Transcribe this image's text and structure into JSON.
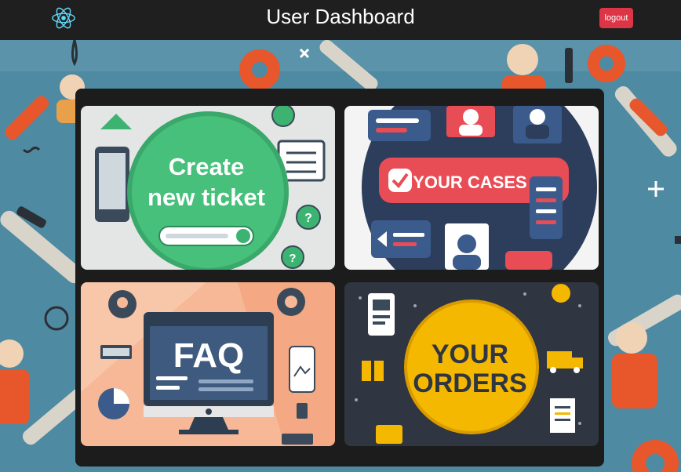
{
  "header": {
    "title": "User Dashboard",
    "logout_label": "logout"
  },
  "cards": {
    "create_ticket": {
      "line1": "Create",
      "line2": "new ticket"
    },
    "your_cases": {
      "label": "YOUR CASES"
    },
    "faq": {
      "label": "FAQ"
    },
    "your_orders": {
      "line1": "YOUR",
      "line2": "ORDERS"
    }
  },
  "colors": {
    "header_bg": "#1f1f1f",
    "logout_bg": "#dc3545",
    "react_logo": "#61dafb",
    "panel_bg": "#1c1c1c",
    "wallpaper": "#4f8aa3"
  }
}
